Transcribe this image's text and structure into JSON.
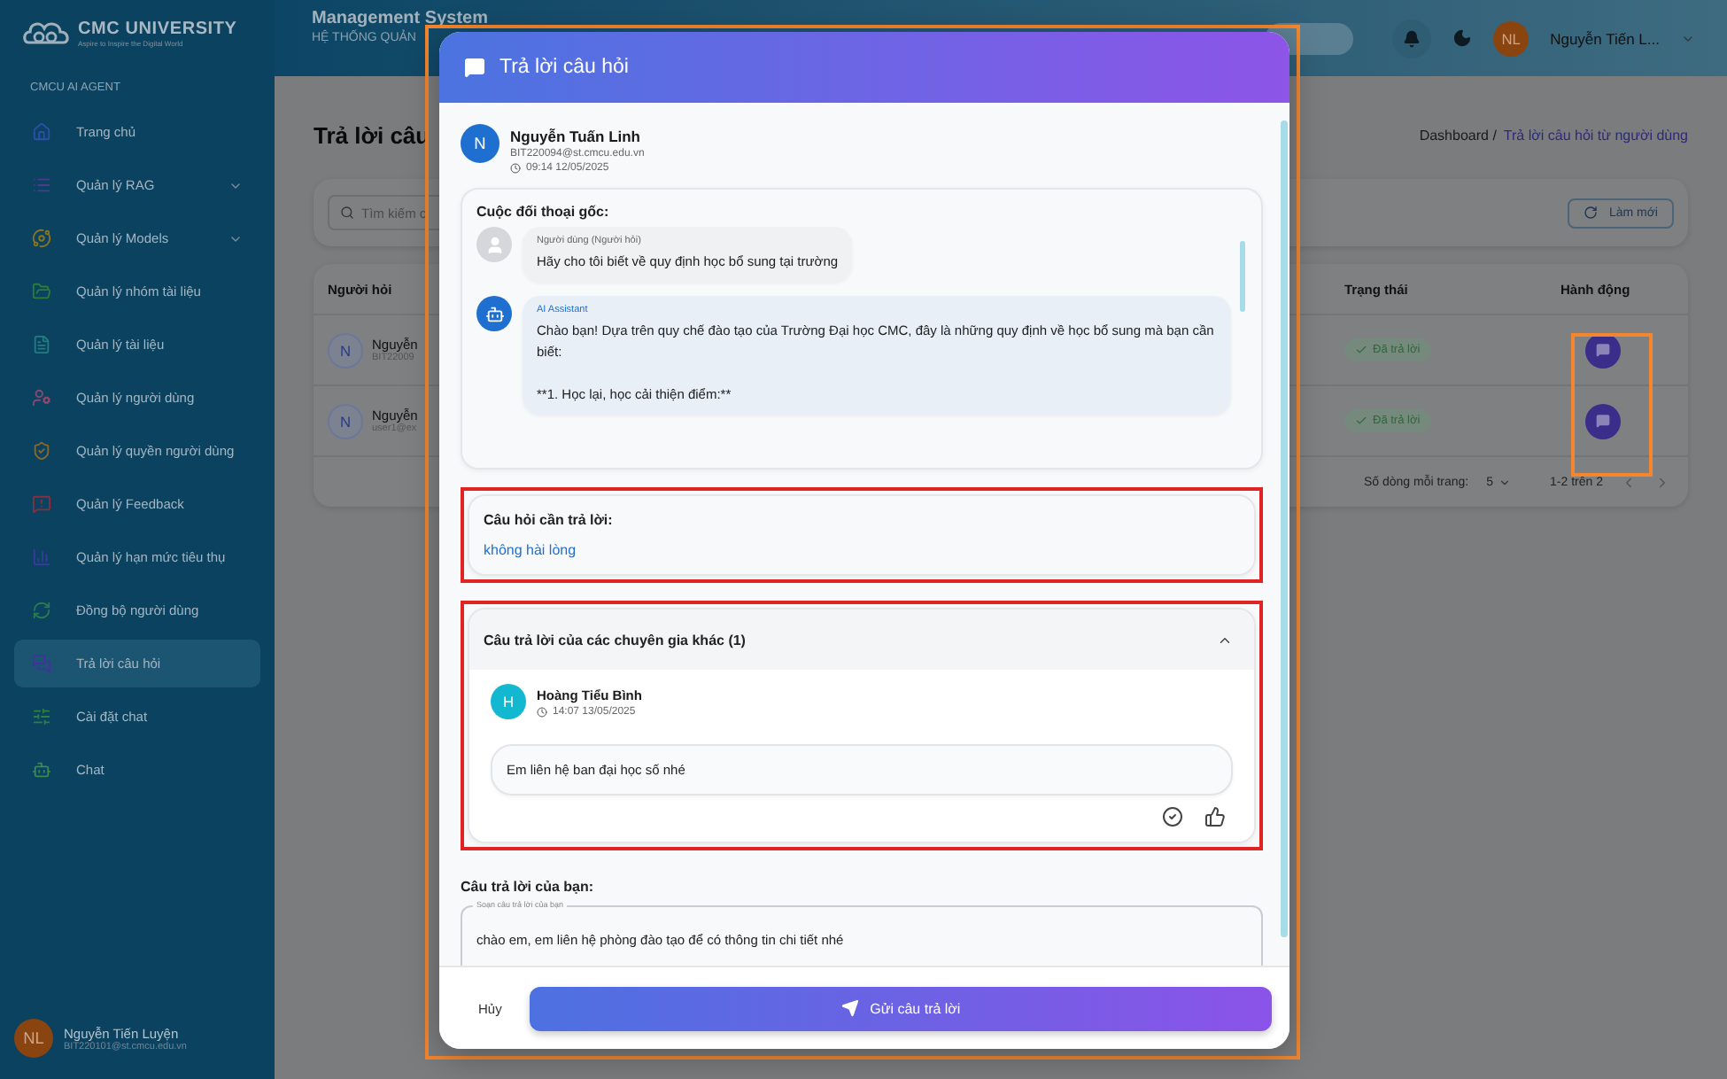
{
  "sidebar": {
    "logo_title": "CMC UNIVERSITY",
    "logo_tagline": "Aspire to Inspire the Digital World",
    "section": "CMCU AI AGENT",
    "items": [
      {
        "label": "Trang chủ",
        "expandable": false,
        "selected": false
      },
      {
        "label": "Quản lý RAG",
        "expandable": true,
        "selected": false
      },
      {
        "label": "Quản lý Models",
        "expandable": true,
        "selected": false
      },
      {
        "label": "Quản lý nhóm tài liệu",
        "expandable": false,
        "selected": false
      },
      {
        "label": "Quản lý tài liệu",
        "expandable": false,
        "selected": false
      },
      {
        "label": "Quản lý người dùng",
        "expandable": false,
        "selected": false
      },
      {
        "label": "Quản lý quyền người dùng",
        "expandable": false,
        "selected": false
      },
      {
        "label": "Quản lý Feedback",
        "expandable": false,
        "selected": false
      },
      {
        "label": "Quản lý hạn mức tiêu thụ",
        "expandable": false,
        "selected": false
      },
      {
        "label": "Đồng bộ người dùng",
        "expandable": false,
        "selected": false
      },
      {
        "label": "Trả lời câu hỏi",
        "expandable": false,
        "selected": true
      },
      {
        "label": "Cài đặt chat",
        "expandable": false,
        "selected": false
      },
      {
        "label": "Chat",
        "expandable": false,
        "selected": false
      }
    ],
    "user": {
      "initials": "NL",
      "name": "Nguyễn Tiến Luyện",
      "email": "BIT220101@st.cmcu.edu.vn"
    }
  },
  "topbar": {
    "title": "Management System",
    "subtitle": "HỆ THỐNG QUẢN",
    "user_initials": "NL",
    "user_name": "Nguyễn Tiến L..."
  },
  "page": {
    "title": "Trả lời câu",
    "breadcrumb": {
      "root": "Dashboard /",
      "current": "Trả lời câu hỏi từ người dùng"
    },
    "search_placeholder": "Tìm kiếm c",
    "refresh_label": "Làm mới",
    "table": {
      "columns": [
        "Người hỏi",
        "Trạng thái",
        "Hành động"
      ],
      "rows": [
        {
          "initials": "N",
          "name": "Nguyễn",
          "email": "BIT22009",
          "status": "Đã trả lời"
        },
        {
          "initials": "N",
          "name": "Nguyễn",
          "email": "user1@ex",
          "status": "Đã trả lời"
        }
      ],
      "pagination": {
        "rows_label": "Số dòng mỗi trang:",
        "rows_value": "5",
        "range": "1-2 trên 2"
      }
    }
  },
  "modal": {
    "title": "Trả lời câu hỏi",
    "asker": {
      "initials": "N",
      "name": "Nguyễn Tuấn Linh",
      "email": "BIT220094@st.cmcu.edu.vn",
      "time": "09:14 12/05/2025"
    },
    "conversation": {
      "title": "Cuộc đối thoại gốc:",
      "messages": [
        {
          "kind": "user",
          "sender": "Người dùng (Người hỏi)",
          "text": "Hãy cho tôi biết về quy định học bổ sung tại trường"
        },
        {
          "kind": "assistant",
          "sender": "AI Assistant",
          "text": "Chào bạn! Dựa trên quy chế đào tạo của Trường Đại học CMC, đây là những quy định về học bổ sung mà bạn cần biết:\n\n**1. Học lại, học cải thiện điểm:**"
        }
      ]
    },
    "question": {
      "title": "Câu hỏi cần trả lời:",
      "text": "không hài lòng"
    },
    "other_answers": {
      "title": "Câu trả lời của các chuyên gia khác (1)",
      "expanded": true,
      "answers": [
        {
          "initials": "H",
          "name": "Hoàng Tiểu Bình",
          "time": "14:07 13/05/2025",
          "text": "Em liên hệ ban đại học số nhé"
        }
      ]
    },
    "your_answer": {
      "title": "Câu trả lời của bạn:",
      "label": "Soạn câu trả lời của bạn",
      "value": "chào em, em liên hệ phòng đào tạo để có thông tin chi tiết nhé"
    },
    "cancel_label": "Hủy",
    "submit_label": "Gửi câu trả lời"
  }
}
